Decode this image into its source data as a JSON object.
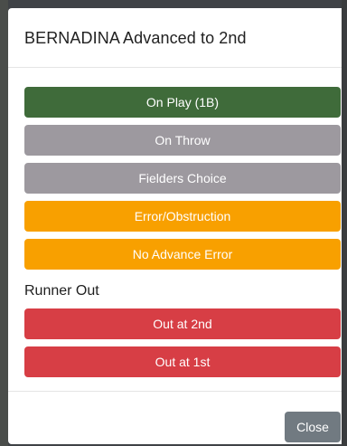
{
  "modal": {
    "title": "BERNADINA Advanced to 2nd"
  },
  "advance_options": [
    {
      "label": "On Play (1B)",
      "color": "#3f6b3a"
    },
    {
      "label": "On Throw",
      "color": "#9d999f"
    },
    {
      "label": "Fielders Choice",
      "color": "#9d999f"
    },
    {
      "label": "Error/Obstruction",
      "color": "#f8a000"
    },
    {
      "label": "No Advance Error",
      "color": "#f8a000"
    }
  ],
  "runner_out": {
    "heading": "Runner Out",
    "options": [
      {
        "label": "Out at 2nd",
        "color": "#d73e45"
      },
      {
        "label": "Out at 1st",
        "color": "#d73e45"
      }
    ]
  },
  "footer": {
    "close_label": "Close"
  }
}
